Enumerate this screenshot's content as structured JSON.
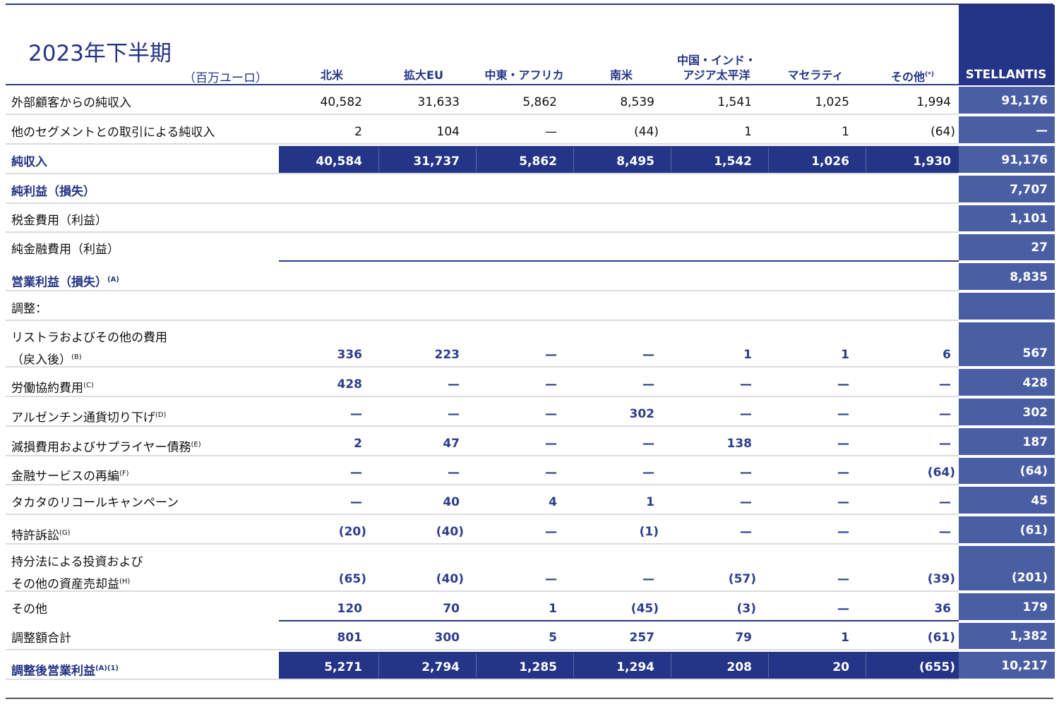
{
  "title": "2023年下半期",
  "unit": "（百万ユーロ）",
  "columns": [
    {
      "key": "na",
      "label": "北米"
    },
    {
      "key": "eu",
      "label": "拡大EU"
    },
    {
      "key": "mea",
      "label": "中東・アフリカ"
    },
    {
      "key": "sa",
      "label": "南米"
    },
    {
      "key": "cia_line1",
      "label": "中国・インド・"
    },
    {
      "key": "cia_line2",
      "label": "アジア太平洋"
    },
    {
      "key": "mas",
      "label": "マセラティ"
    },
    {
      "key": "other",
      "label": "その他",
      "note": "(*)"
    },
    {
      "key": "stellantis",
      "label": "STELLANTIS"
    }
  ],
  "rows": [
    {
      "label": "外部顧客からの純収入",
      "values": [
        "40,582",
        "31,633",
        "5,862",
        "8,539",
        "1,541",
        "1,025",
        "1,994"
      ],
      "total": "91,176"
    },
    {
      "label": "他のセグメントとの取引による純収入",
      "values": [
        "2",
        "104",
        "—",
        "(44)",
        "1",
        "1",
        "(64)"
      ],
      "total": "—"
    },
    {
      "label": "純収入",
      "values": [
        "40,584",
        "31,737",
        "5,862",
        "8,495",
        "1,542",
        "1,026",
        "1,930"
      ],
      "total": "91,176"
    },
    {
      "label": "純利益（損失）",
      "values": [],
      "total": "7,707"
    },
    {
      "label": "税金費用（利益）",
      "values": [],
      "total": "1,101"
    },
    {
      "label": "純金融費用（利益）",
      "values": [],
      "total": "27"
    },
    {
      "label": "営業利益（損失）",
      "note": "(A)",
      "values": [],
      "total": "8,835"
    },
    {
      "label": "調整：",
      "values": [],
      "total": ""
    },
    {
      "label": "リストラおよびその他の費用",
      "label2": "（戻入後）",
      "note": "(B)",
      "values": [
        "336",
        "223",
        "—",
        "—",
        "1",
        "1",
        "6"
      ],
      "total": "567"
    },
    {
      "label": "労働協約費用",
      "note": "(C)",
      "values": [
        "428",
        "—",
        "—",
        "—",
        "—",
        "—",
        "—"
      ],
      "total": "428"
    },
    {
      "label": "アルゼンチン通貨切り下げ",
      "note": "(D)",
      "values": [
        "—",
        "—",
        "—",
        "302",
        "—",
        "—",
        "—"
      ],
      "total": "302"
    },
    {
      "label": "減損費用およびサプライヤー債務",
      "note": "(E)",
      "values": [
        "2",
        "47",
        "—",
        "—",
        "138",
        "—",
        "—"
      ],
      "total": "187"
    },
    {
      "label": "金融サービスの再編",
      "note": "(F)",
      "values": [
        "—",
        "—",
        "—",
        "—",
        "—",
        "—",
        "(64)"
      ],
      "total": "(64)"
    },
    {
      "label": "タカタのリコールキャンペーン",
      "values": [
        "—",
        "40",
        "4",
        "1",
        "—",
        "—",
        "—"
      ],
      "total": "45"
    },
    {
      "label": "特許訴訟",
      "note": "(G)",
      "values": [
        "(20)",
        "(40)",
        "—",
        "(1)",
        "—",
        "—",
        "—"
      ],
      "total": "(61)"
    },
    {
      "label": "持分法による投資および",
      "label2": "その他の資産売却益",
      "note": "(H)",
      "values": [
        "(65)",
        "(40)",
        "—",
        "—",
        "(57)",
        "—",
        "(39)"
      ],
      "total": "(201)"
    },
    {
      "label": "その他",
      "values": [
        "120",
        "70",
        "1",
        "(45)",
        "(3)",
        "—",
        "36"
      ],
      "total": "179"
    },
    {
      "label": "調整額合計",
      "values": [
        "801",
        "300",
        "5",
        "257",
        "79",
        "1",
        "(61)"
      ],
      "total": "1,382"
    },
    {
      "label": "調整後営業利益",
      "note": "(A)(1)",
      "values": [
        "5,271",
        "2,794",
        "1,285",
        "1,294",
        "208",
        "20",
        "(655)"
      ],
      "total": "10,217"
    }
  ]
}
